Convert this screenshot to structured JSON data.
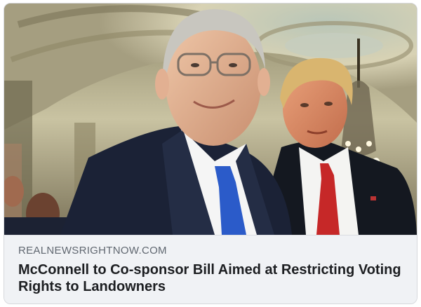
{
  "link_preview": {
    "domain": "REALNEWSRIGHTNOW.COM",
    "headline": "McConnell to Co-sponsor Bill Aimed at Restricting Voting Rights to Landowners",
    "image": {
      "alt": "Photo of two men in suits in an ornate domed hallway",
      "subjects": [
        "older man in navy suit with blue tie and glasses",
        "man in dark suit with red tie and flag pin"
      ],
      "background": "arched hallway with chandelier"
    }
  },
  "colors": {
    "card_background": "#f0f2f5",
    "domain_text": "#606770",
    "headline_text": "#1c1e21",
    "border": "#d6d8dc"
  }
}
